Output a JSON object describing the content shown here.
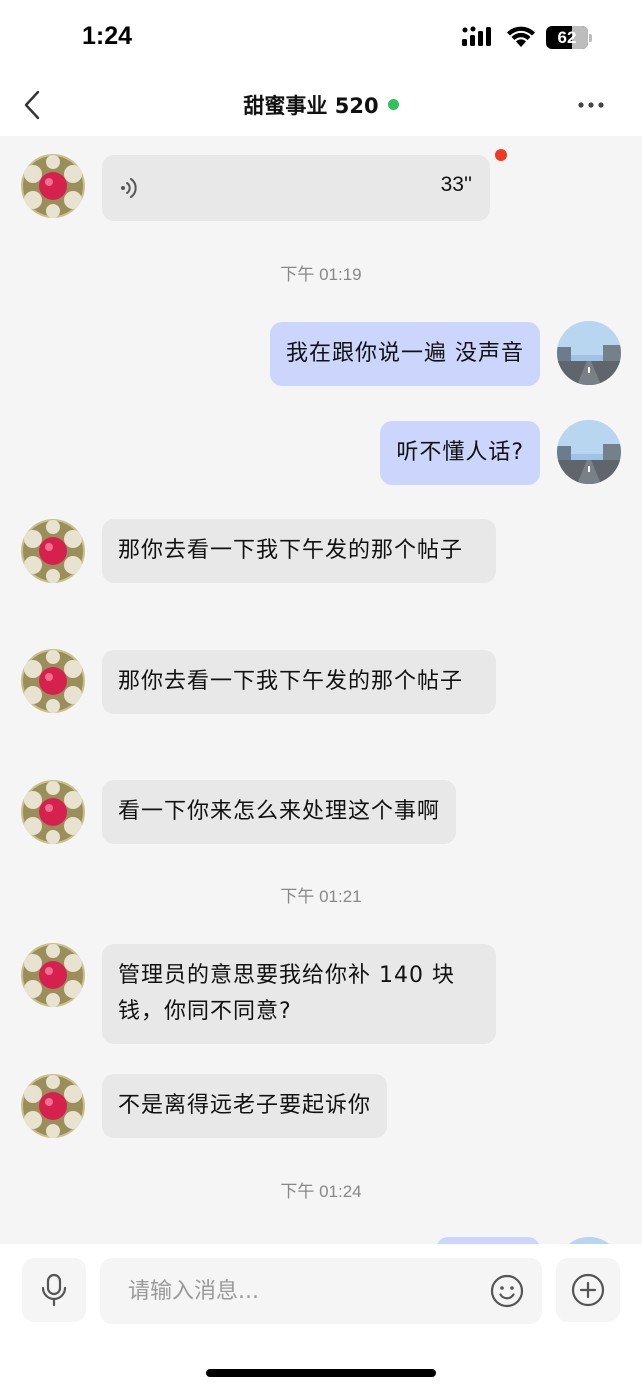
{
  "status_bar": {
    "time": "1:24",
    "battery": "62",
    "battery_level": 0.62
  },
  "header": {
    "title": "甜蜜事业 520",
    "online_color": "#2fc25b"
  },
  "colors": {
    "incoming_bubble": "#e8e8e8",
    "outgoing_bubble": "#ccd6fc",
    "unread_dot": "#f03a22"
  },
  "messages": {
    "m0": {
      "type": "voice",
      "side": "in",
      "duration": "33''",
      "unread": true
    },
    "t1": {
      "type": "timestamp",
      "text": "下午 01:19"
    },
    "m1": {
      "type": "text",
      "side": "out",
      "text": "我在跟你说一遍 没声音"
    },
    "m2": {
      "type": "text",
      "side": "out",
      "text": "听不懂人话?"
    },
    "m3": {
      "type": "text",
      "side": "in",
      "text": "那你去看一下我下午发的那个帖子"
    },
    "m4": {
      "type": "text",
      "side": "in",
      "text": "那你去看一下我下午发的那个帖子"
    },
    "m5": {
      "type": "text",
      "side": "in",
      "text": "看一下你来怎么来处理这个事啊"
    },
    "t2": {
      "type": "timestamp",
      "text": "下午 01:21"
    },
    "m6": {
      "type": "text",
      "side": "in",
      "text": "管理员的意思要我给你补 140 块钱，你同不同意?"
    },
    "m7": {
      "type": "text",
      "side": "in",
      "text": "不是离得远老子要起诉你"
    },
    "t3": {
      "type": "timestamp",
      "text": "下午 01:24"
    }
  },
  "input_bar": {
    "placeholder": "请输入消息..."
  },
  "icons": [
    "signal-icon",
    "wifi-icon",
    "battery-icon",
    "back-icon",
    "more-icon",
    "voice-wave-icon",
    "microphone-icon",
    "emoji-icon",
    "plus-circle-icon"
  ]
}
